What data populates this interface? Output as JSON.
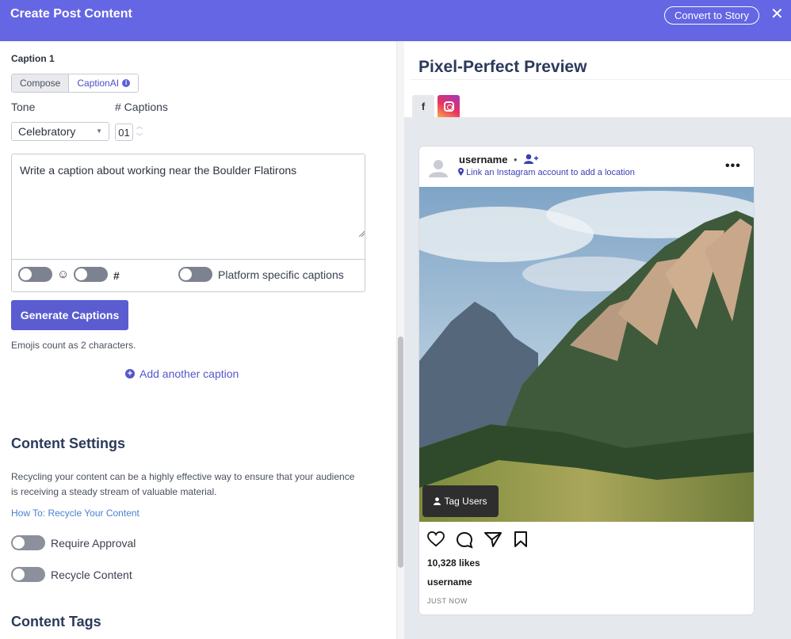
{
  "header": {
    "title": "Create Post Content",
    "story_button": "Convert to Story",
    "close": "✕"
  },
  "caption": {
    "heading": "Caption 1",
    "tabs": [
      "Compose",
      "CaptionAI"
    ],
    "tone_label": "Tone",
    "tone_value": "Celebratory",
    "count_label": "# Captions",
    "count_value": "01",
    "textarea_value": "Write a caption about working near the Boulder Flatirons",
    "emoji_symbol": "☺",
    "hashtag_symbol": "#",
    "platform_label": "Platform specific captions",
    "generate_button": "Generate Captions",
    "note": "Emojis count as 2 characters.",
    "add_caption": "Add another caption"
  },
  "content_settings": {
    "title": "Content Settings",
    "description": "Recycling your content can be a highly effective way to ensure that your audience is receiving a steady stream of valuable material.",
    "howto_link": "How To: Recycle Your Content",
    "require_approval": "Require Approval",
    "recycle_content": "Recycle Content"
  },
  "content_tags": {
    "title": "Content Tags"
  },
  "preview": {
    "title": "Pixel-Perfect Preview",
    "tabs": [
      {
        "name": "facebook",
        "label": "f"
      },
      {
        "name": "instagram",
        "icon": "instagram-icon"
      }
    ],
    "post": {
      "username": "username",
      "dot": "•",
      "location": "Link an Instagram account to add a location",
      "more": "•••",
      "tag_users": "Tag Users",
      "likes": "10,328 likes",
      "caption_user": "username",
      "time": "JUST NOW"
    }
  },
  "colors": {
    "header": "#6466e3",
    "accent": "#5a5cd0",
    "preview_bg": "#e5e8ed"
  }
}
